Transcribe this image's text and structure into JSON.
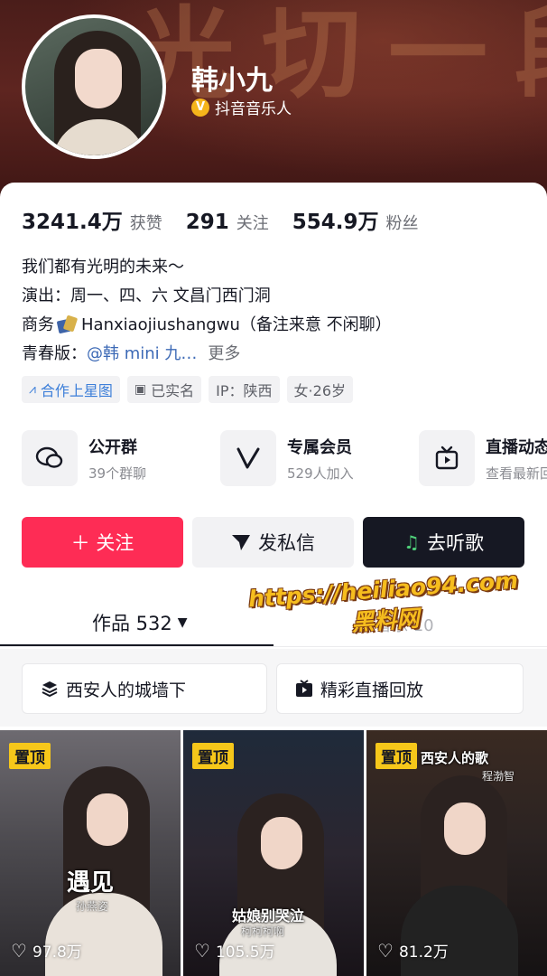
{
  "header": {
    "banner_text": "光切一段",
    "name": "韩小九",
    "verify_mark": "V",
    "verified_label": "抖音音乐人"
  },
  "stats": [
    {
      "value": "3241.4万",
      "label": "获赞"
    },
    {
      "value": "291",
      "label": "关注"
    },
    {
      "value": "554.9万",
      "label": "粉丝"
    }
  ],
  "bio": {
    "line1": "我们都有光明的未来～",
    "line2": "演出：周一、四、六 文昌门西门洞",
    "line3_prefix": "商务",
    "line3_text": "Hanxiaojiushangwu（备注来意 不闲聊）",
    "line4_prefix": "青春版：",
    "line4_link": "@韩 mini 九…",
    "line4_more": "更多"
  },
  "tags": [
    {
      "label": "合作上星图",
      "icon": "star-map-icon"
    },
    {
      "label": "已实名",
      "icon": "id-card-icon"
    },
    {
      "label": "IP：陕西",
      "icon": ""
    },
    {
      "label": "女·26岁",
      "icon": ""
    }
  ],
  "features": [
    {
      "title": "公开群",
      "subtitle": "39个群聊",
      "icon": "chat-bubbles-icon"
    },
    {
      "title": "专属会员",
      "subtitle": "529人加入",
      "icon": "v-member-icon"
    },
    {
      "title": "直播动态",
      "subtitle": "查看最新回",
      "icon": "tv-play-icon"
    }
  ],
  "actions": {
    "follow": "＋ 关注",
    "message": "发私信",
    "music": "去听歌"
  },
  "tabs": {
    "works_label": "作品 532",
    "caret": "▼",
    "music_label": "音乐 10"
  },
  "watermark": {
    "url": "https://heiliao94.com",
    "text": "黑料网"
  },
  "collections": [
    {
      "label": "西安人的城墙下",
      "icon": "layers-icon"
    },
    {
      "label": "精彩直播回放",
      "icon": "live-replay-icon"
    }
  ],
  "videos": [
    {
      "pin": "置顶",
      "title": "遇见",
      "subtitle": "孙燕姿",
      "likes": "97.8万"
    },
    {
      "pin": "置顶",
      "title": "姑娘别哭泣",
      "subtitle": "柯柯柯啊",
      "likes": "105.5万"
    },
    {
      "pin": "置顶",
      "title": "西安人的歌",
      "subtitle": "程渤智",
      "likes": "81.2万"
    }
  ],
  "colors": {
    "accent": "#fe2c55",
    "dark_button": "#161823",
    "link": "#3d6ab6",
    "pin_badge": "#f6c71a",
    "verify_badge": "#f5b51b"
  }
}
